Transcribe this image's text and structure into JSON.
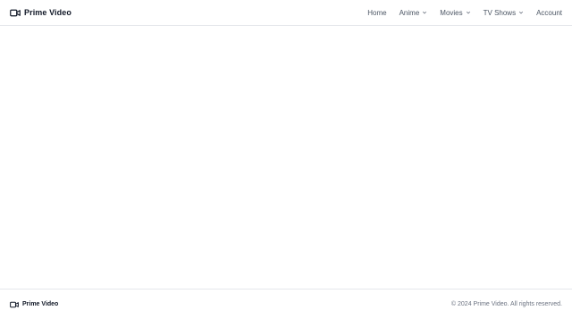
{
  "app": {
    "name": "Prime Video"
  },
  "header": {
    "brand_label": "Prime Video",
    "brand_icon": "video-camera-icon",
    "nav": [
      {
        "label": "Home",
        "has_dropdown": false
      },
      {
        "label": "Anime",
        "has_dropdown": true
      },
      {
        "label": "Movies",
        "has_dropdown": true
      },
      {
        "label": "TV Shows",
        "has_dropdown": true
      },
      {
        "label": "Account",
        "has_dropdown": false
      }
    ]
  },
  "footer": {
    "brand_label": "Prime Video",
    "brand_icon": "video-camera-icon",
    "copyright": "© 2024 Prime Video. All rights reserved."
  },
  "colors": {
    "background": "#ffffff",
    "border": "#e5e7eb",
    "text_primary": "#111827",
    "text_nav": "#4b5563",
    "text_muted": "#6b7280"
  }
}
